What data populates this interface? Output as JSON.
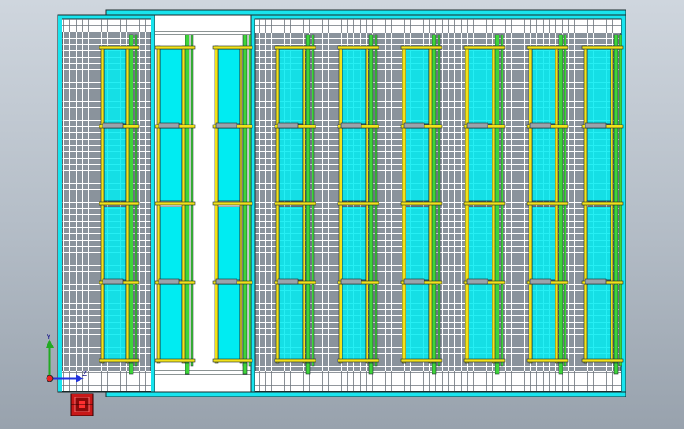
{
  "viewport": {
    "background_top": "#cfd6de",
    "background_bottom": "#98a2ad"
  },
  "colors": {
    "frame_cyan": "#18e4ee",
    "panel_cyan": "#00ecf2",
    "outline": "#1a2a2a",
    "rail_yellow": "#f2e21a",
    "rail_green": "#3ed43a",
    "mesh_white": "#ffffff",
    "mesh_gray": "#8a939c",
    "axis_y": "#22aa22",
    "axis_z": "#2233dd",
    "origin_red": "#ee2222",
    "triad_red": "#c81818"
  },
  "triad": {
    "y_label": "Y",
    "z_label": "Z",
    "icon": "view-orientation-triad-icon"
  },
  "frames": {
    "left_count": 1,
    "center_count": 2,
    "right_count": 6
  }
}
